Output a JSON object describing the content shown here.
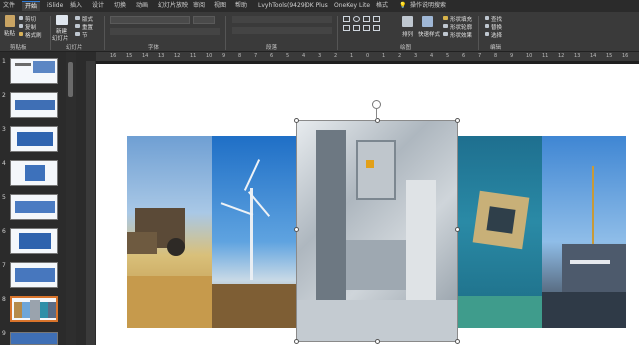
{
  "menu": {
    "tabs": [
      "文件",
      "开始",
      "iSlide",
      "插入",
      "设计",
      "切换",
      "动画",
      "幻灯片放映",
      "审阅",
      "视图",
      "帮助",
      "LvyhTools(9429)",
      "OK Plus",
      "OneKey Lite",
      "格式"
    ],
    "active": "开始",
    "tell_me": "操作说明搜索"
  },
  "ribbon": {
    "groups": [
      "剪贴板",
      "幻灯片",
      "字体",
      "段落",
      "绘图",
      "编辑"
    ],
    "clipboard": {
      "paste": "粘贴",
      "cut": "剪切",
      "copy": "复制",
      "format_painter": "格式刷"
    },
    "slides": {
      "new": "新建",
      "new2": "幻灯片",
      "layout": "版式",
      "reset": "重置",
      "section": "节"
    },
    "drawing": {
      "arrange": "排列",
      "quick_styles": "快速样式",
      "shape_fill": "形状填充",
      "shape_outline": "形状轮廓",
      "shape_effects": "形状效果"
    },
    "editing": {
      "find": "查找",
      "replace": "替换",
      "select": "选择"
    }
  },
  "ruler": {
    "labels": [
      "16",
      "15",
      "14",
      "13",
      "12",
      "11",
      "10",
      "9",
      "8",
      "7",
      "6",
      "5",
      "4",
      "3",
      "2",
      "1",
      "0",
      "1",
      "2",
      "3",
      "4",
      "5",
      "6",
      "7",
      "8",
      "9",
      "10",
      "11",
      "12",
      "13",
      "14",
      "15",
      "16"
    ]
  },
  "thumbnails": {
    "numbers": [
      "1",
      "2",
      "3",
      "4",
      "5",
      "6",
      "7",
      "8",
      "9"
    ],
    "selected": "8"
  },
  "slide": {
    "panels": [
      "harvester-field",
      "wind-turbine",
      "factory-machinery",
      "circuit-chip",
      "ship-harbor"
    ]
  },
  "colors": {
    "accent": "#2f7bd6",
    "selection": "#d9742b"
  }
}
